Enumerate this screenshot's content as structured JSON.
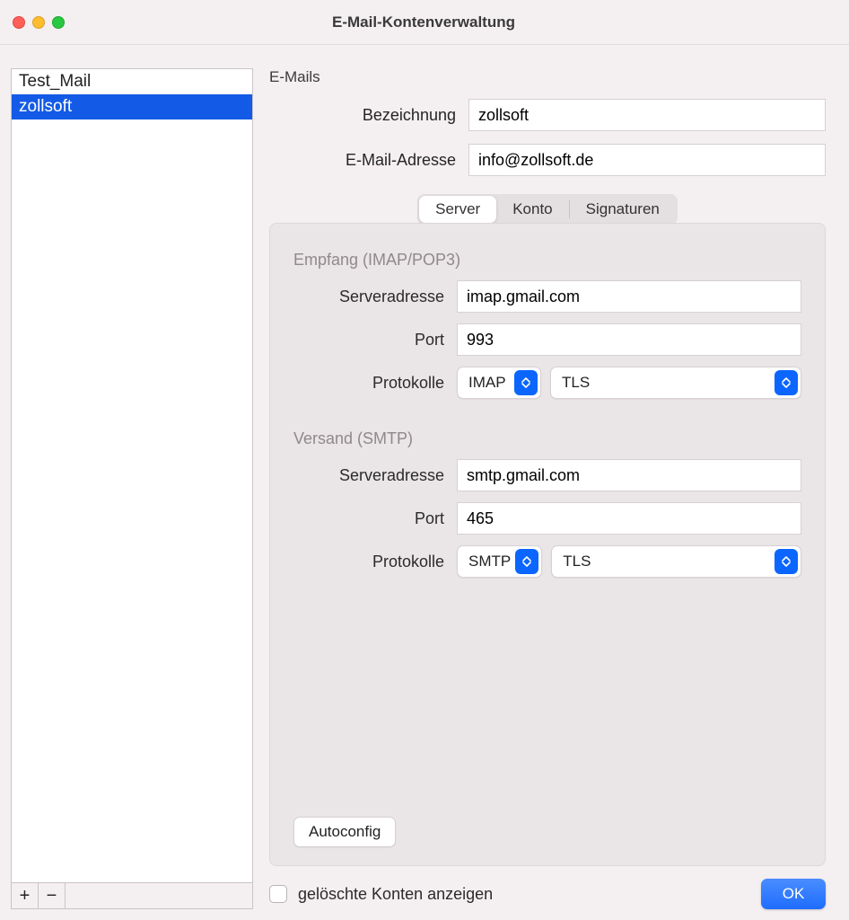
{
  "window": {
    "title": "E-Mail-Kontenverwaltung"
  },
  "sidebar": {
    "accounts": [
      {
        "name": "Test_Mail",
        "selected": false
      },
      {
        "name": "zollsoft",
        "selected": true
      }
    ],
    "add_symbol": "+",
    "remove_symbol": "−"
  },
  "main": {
    "section_title": "E-Mails",
    "bezeichnung_label": "Bezeichnung",
    "bezeichnung_value": "zollsoft",
    "email_label": "E-Mail-Adresse",
    "email_value": "info@zollsoft.de",
    "tabs": {
      "server": "Server",
      "konto": "Konto",
      "signaturen": "Signaturen"
    },
    "empfang": {
      "title": "Empfang (IMAP/POP3)",
      "server_label": "Serveradresse",
      "server_value": "imap.gmail.com",
      "port_label": "Port",
      "port_value": "993",
      "proto_label": "Protokolle",
      "proto1": "IMAP",
      "proto2": "TLS"
    },
    "versand": {
      "title": "Versand (SMTP)",
      "server_label": "Serveradresse",
      "server_value": "smtp.gmail.com",
      "port_label": "Port",
      "port_value": "465",
      "proto_label": "Protokolle",
      "proto1": "SMTP",
      "proto2": "TLS"
    },
    "autoconfig": "Autoconfig"
  },
  "footer": {
    "show_deleted_label": "gelöschte Konten anzeigen",
    "ok": "OK"
  }
}
